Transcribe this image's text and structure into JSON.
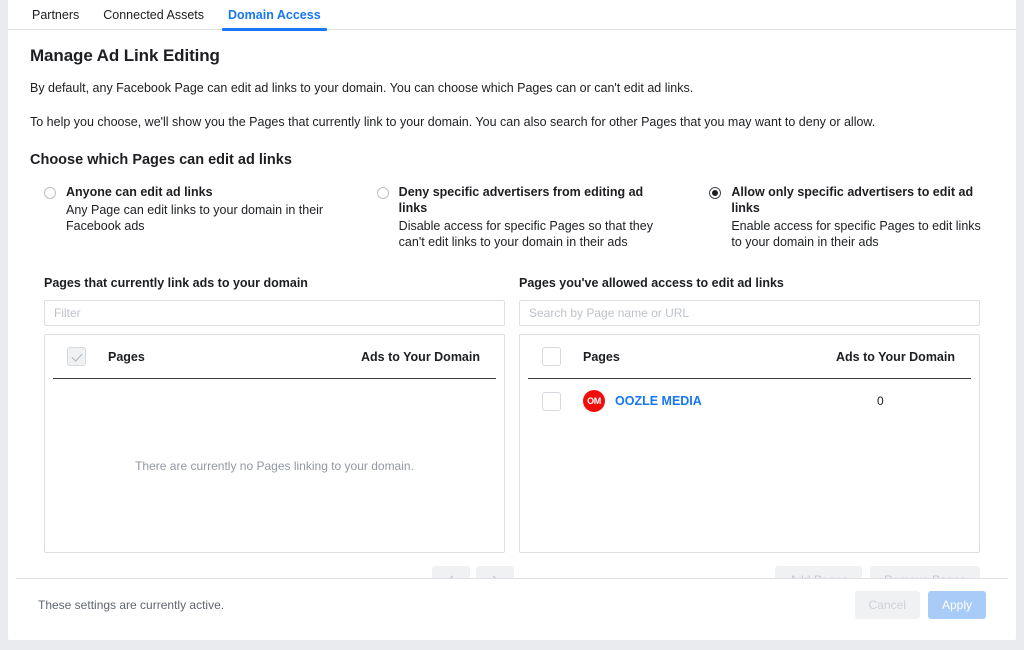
{
  "tabs": [
    {
      "label": "Partners",
      "active": false
    },
    {
      "label": "Connected Assets",
      "active": false
    },
    {
      "label": "Domain Access",
      "active": true
    }
  ],
  "header": {
    "title": "Manage Ad Link Editing",
    "intro_1": "By default, any Facebook Page can edit ad links to your domain. You can choose which Pages can or can't edit ad links.",
    "intro_2": "To help you choose, we'll show you the Pages that currently link to your domain. You can also search for other Pages that you may want to deny or allow.",
    "subtitle": "Choose which Pages can edit ad links"
  },
  "options": [
    {
      "label": "Anyone can edit ad links",
      "desc": "Any Page can edit links to your domain in their Facebook ads",
      "selected": false
    },
    {
      "label": "Deny specific advertisers from editing ad links",
      "desc": "Disable access for specific Pages so that they can't edit links to your domain in their ads",
      "selected": false
    },
    {
      "label": "Allow only specific advertisers to edit ad links",
      "desc": "Enable access for specific Pages to edit links to your domain in their ads",
      "selected": true
    }
  ],
  "left_panel": {
    "title": "Pages that currently link ads to your domain",
    "filter_placeholder": "Filter",
    "filter_value": "",
    "col_pages": "Pages",
    "col_ads": "Ads to Your Domain",
    "empty_message": "There are currently no Pages linking to your domain.",
    "header_checkbox_state": "checked-disabled"
  },
  "right_panel": {
    "title": "Pages you've allowed access to edit ad links",
    "search_placeholder": "Search by Page name or URL",
    "search_value": "",
    "col_pages": "Pages",
    "col_ads": "Ads to Your Domain",
    "rows": [
      {
        "name": "OOZLE MEDIA",
        "avatar_initials": "OM",
        "avatar_color": "#f20d0d",
        "ads_count": "0",
        "checked": false
      }
    ]
  },
  "pager": {
    "prev_icon": "chevron-left-icon",
    "next_icon": "chevron-right-icon"
  },
  "buttons": {
    "add_pages": "Add Pages",
    "remove_pages": "Remove Pages"
  },
  "footer": {
    "note": "These settings are currently active.",
    "cancel": "Cancel",
    "apply": "Apply"
  },
  "colors": {
    "accent": "#1877f2",
    "brand_red": "#f20d0d",
    "apply_disabled": "#a8ccf7"
  }
}
